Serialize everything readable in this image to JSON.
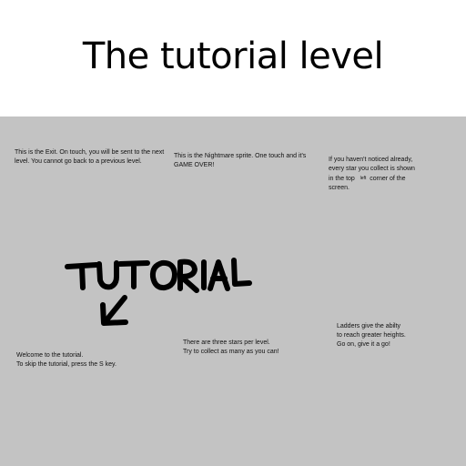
{
  "page_title": "The tutorial level",
  "game": {
    "background_color": "#c3c3c3",
    "hints": {
      "exit": {
        "line1": "This is the Exit. On touch, you will be sent to the next",
        "line2": "level. You cannot go back to a previous level."
      },
      "nightmare": {
        "line1": "This is the Nightmare sprite. One touch and it's",
        "line2": "GAME OVER!"
      },
      "stars_hud": {
        "line1": "If you haven't noticed already,",
        "line2": "every star you collect is shown",
        "line3_a": "in the top",
        "line3_b": "left",
        "line3_c": "corner of the",
        "line4": "screen."
      },
      "ladders": {
        "line1": "Ladders give the abilty",
        "line2": "to reach greater heights.",
        "line3": "Go on, give it a go!"
      },
      "stars_count": {
        "line1": "There are three stars per level.",
        "line2": "Try to collect as many as you can!"
      },
      "welcome": {
        "line1": "Welcome to the tutorial.",
        "line2": "To skip the tutorial, press the S key."
      }
    },
    "scribble": {
      "text": "TUTORIAL",
      "arrow_icon": "down-left-arrow-icon"
    }
  }
}
